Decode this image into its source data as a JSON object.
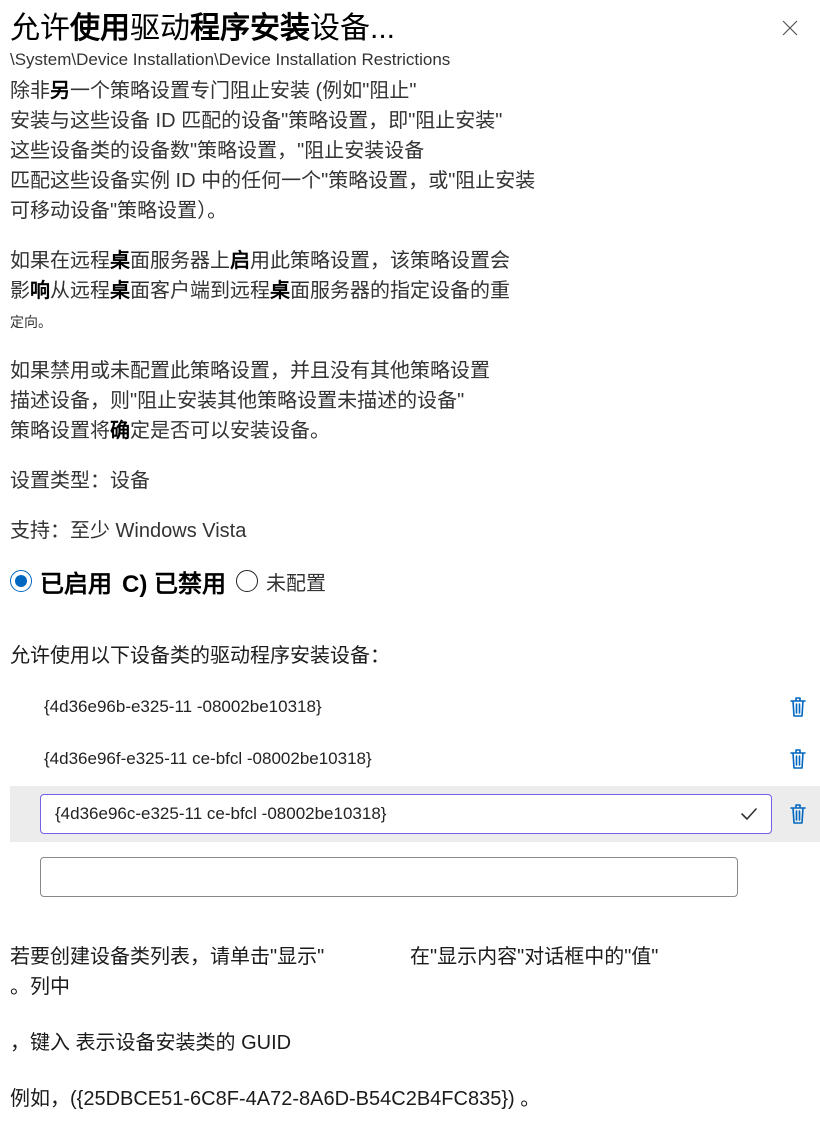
{
  "title_parts": [
    "允许",
    "使用",
    "驱动",
    "程序安装",
    "设备..."
  ],
  "title_bold": [
    0,
    1,
    0,
    1,
    0
  ],
  "breadcrumb": "\\System\\Device Installation\\Device Installation Restrictions",
  "desc_lines": [
    {
      "segs": [
        {
          "t": "除非",
          "b": 0
        },
        {
          "t": "另",
          "b": 1
        },
        {
          "t": "一个策略设置专门阻止安装 (例如\"阻止\"",
          "b": 0
        }
      ]
    },
    {
      "segs": [
        {
          "t": "安装与这些设备 ID 匹配的设备\"策略设置，即\"阻止安装\"",
          "b": 0
        }
      ]
    },
    {
      "segs": [
        {
          "t": "这些设备类的设备数\"策略设置，\"阻止安装设备",
          "b": 0
        }
      ]
    },
    {
      "segs": [
        {
          "t": "匹配这些设备实例 ID 中的任何一个\"策略设置，或\"阻止安装",
          "b": 0
        }
      ]
    },
    {
      "segs": [
        {
          "t": "可移动设备\"策略设置）。",
          "b": 0
        }
      ]
    },
    {
      "segs": [
        {
          "t": "",
          "b": 0
        }
      ]
    },
    {
      "segs": [
        {
          "t": "如果在远程",
          "b": 0
        },
        {
          "t": "桌",
          "b": 1
        },
        {
          "t": "面服务器上",
          "b": 0
        },
        {
          "t": "启",
          "b": 1
        },
        {
          "t": "用此策略设置，该策略设置会",
          "b": 0
        }
      ]
    },
    {
      "segs": [
        {
          "t": "影",
          "b": 0
        },
        {
          "t": "响",
          "b": 1
        },
        {
          "t": "从远程",
          "b": 0
        },
        {
          "t": "桌",
          "b": 1
        },
        {
          "t": "面客户端到远程",
          "b": 0
        },
        {
          "t": "桌",
          "b": 1
        },
        {
          "t": "面服务器的指定设备的重",
          "b": 0
        }
      ]
    },
    {
      "segs": [
        {
          "t": "定向。",
          "b": 0,
          "small": 1
        }
      ]
    },
    {
      "segs": [
        {
          "t": "",
          "b": 0
        }
      ]
    },
    {
      "segs": [
        {
          "t": "如果禁用或未配置此策略设置，并且没有其他策略设置",
          "b": 0
        }
      ]
    },
    {
      "segs": [
        {
          "t": "描述设备，则\"阻止安装其他策略设置未描述的设备\"",
          "b": 0
        }
      ]
    },
    {
      "segs": [
        {
          "t": "策略设置将",
          "b": 0
        },
        {
          "t": "确",
          "b": 1
        },
        {
          "t": "定是否可以安装设备。",
          "b": 0
        }
      ]
    },
    {
      "segs": [
        {
          "t": "",
          "b": 0
        }
      ]
    },
    {
      "segs": [
        {
          "t": "设置类型：设备",
          "b": 0
        }
      ]
    },
    {
      "segs": [
        {
          "t": "",
          "b": 0
        }
      ]
    },
    {
      "segs": [
        {
          "t": "支持：至少 Windows Vista",
          "b": 0
        }
      ]
    }
  ],
  "radio_enabled": "已启用",
  "radio_disabled_group": "C) 已禁用",
  "radio_notconfig": "未配置",
  "list_label": "允许使用以下设备类的驱动程序安装设备：",
  "items": [
    "{4d36e96b-e325-11 -08002be10318}",
    "{4d36e96f-e325-11 ce-bfcl -08002be10318}",
    "{4d36e96c-e325-11 ce-bfcl -08002be10318}"
  ],
  "bottom_left_1": "若要创建设备类列表，请单击\"显示\"",
  "bottom_right_1": "在\"显示内容\"对话框中的\"值\"",
  "bottom_left_2": "。列中",
  "bottom_line3": "，键入  表示设备安装类的 GUID",
  "bottom_line4": "例如，({25DBCE51-6C8F-4A72-8A6D-B54C2B4FC835}) 。"
}
